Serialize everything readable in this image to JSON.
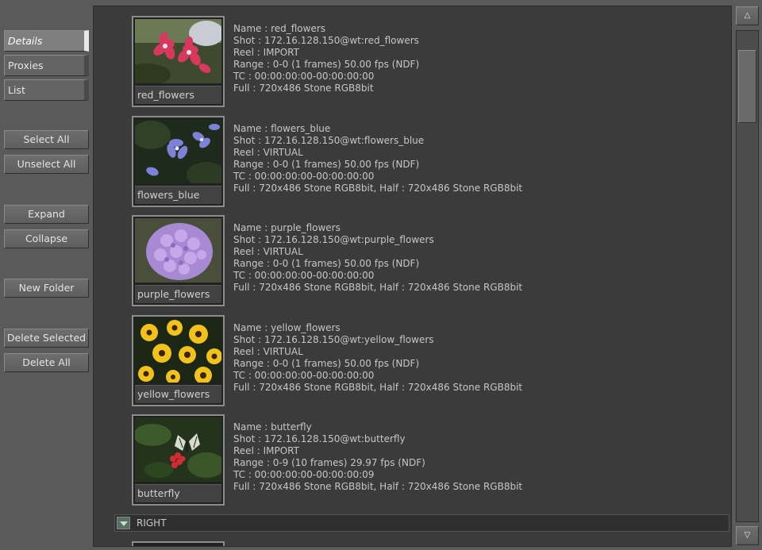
{
  "sidebar": {
    "tabs": [
      {
        "label": "Details",
        "active": true
      },
      {
        "label": "Proxies",
        "active": false
      },
      {
        "label": "List",
        "active": false
      }
    ],
    "buttons": {
      "select_all": "Select All",
      "unselect_all": "Unselect All",
      "expand": "Expand",
      "collapse": "Collapse",
      "new_folder": "New Folder",
      "delete_selected": "Delete Selected",
      "delete_all": "Delete All"
    }
  },
  "clips": [
    {
      "thumb_label": "red_flowers",
      "lines": [
        "Name : red_flowers",
        "Shot : 172.16.128.150@wt:red_flowers",
        "Reel : IMPORT",
        "Range : 0-0 (1 frames) 50.00 fps (NDF)",
        "TC : 00:00:00:00-00:00:00:00",
        "Full : 720x486  Stone RGB8bit"
      ]
    },
    {
      "thumb_label": "flowers_blue",
      "lines": [
        "Name : flowers_blue",
        "Shot : 172.16.128.150@wt:flowers_blue",
        "Reel : VIRTUAL",
        "Range : 0-0 (1 frames) 50.00 fps (NDF)",
        "TC : 00:00:00:00-00:00:00:00",
        "Full : 720x486  Stone RGB8bit,  Half : 720x486  Stone RGB8bit"
      ]
    },
    {
      "thumb_label": "purple_flowers",
      "lines": [
        "Name : purple_flowers",
        "Shot : 172.16.128.150@wt:purple_flowers",
        "Reel : VIRTUAL",
        "Range : 0-0 (1 frames) 50.00 fps (NDF)",
        "TC : 00:00:00:00-00:00:00:00",
        "Full : 720x486  Stone RGB8bit,  Half : 720x486  Stone RGB8bit"
      ]
    },
    {
      "thumb_label": "yellow_flowers",
      "lines": [
        "Name : yellow_flowers",
        "Shot : 172.16.128.150@wt:yellow_flowers",
        "Reel : VIRTUAL",
        "Range : 0-0 (1 frames) 50.00 fps (NDF)",
        "TC : 00:00:00:00-00:00:00:00",
        "Full : 720x486  Stone RGB8bit,  Half : 720x486  Stone RGB8bit"
      ]
    },
    {
      "thumb_label": "butterfly",
      "lines": [
        "Name : butterfly",
        "Shot : 172.16.128.150@wt:butterfly",
        "Reel : IMPORT",
        "Range : 0-9 (10 frames) 29.97 fps (NDF)",
        "TC : 00:00:00:00-00:00:00:09",
        "Full : 720x486  Stone RGB8bit,  Half : 720x486  Stone RGB8bit"
      ]
    }
  ],
  "folder": {
    "label": "RIGHT",
    "icon": "chevron-down-icon"
  },
  "scrollbar": {
    "up_glyph": "△",
    "down_glyph": "▽"
  }
}
